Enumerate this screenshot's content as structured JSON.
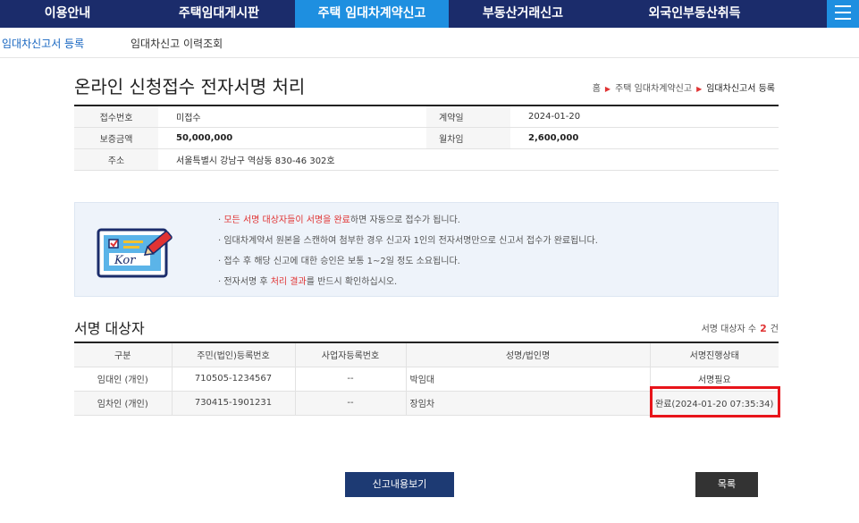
{
  "topnav": {
    "items": [
      "이용안내",
      "주택임대게시판",
      "주택 임대차계약신고",
      "부동산거래신고",
      "외국인부동산취득"
    ],
    "active_index": 2
  },
  "subnav": {
    "items": [
      "임대차신고서 등록",
      "임대차신고 이력조회"
    ]
  },
  "page": {
    "title": "온라인 신청접수 전자서명 처리",
    "breadcrumb": [
      "홈",
      "주택 임대차계약신고",
      "임대차신고서 등록"
    ]
  },
  "info": {
    "receipt_label": "접수번호",
    "receipt_value": "미접수",
    "contract_date_label": "계약일",
    "contract_date_value": "2024-01-20",
    "deposit_label": "보증금액",
    "deposit_value": "50,000,000",
    "rent_label": "월차임",
    "rent_value": "2,600,000",
    "address_label": "주소",
    "address_value": "서울특별시 강남구 역삼동 830-46 302호"
  },
  "notice": {
    "icon_text": "Kor",
    "line1_prefix": "· ",
    "line1_red": "모든 서명 대상자들이 서명을 완료",
    "line1_rest": "하면 자동으로 접수가 됩니다.",
    "line2": "· 임대차계약서 원본을 스캔하여 첨부한 경우 신고자 1인의 전자서명만으로 신고서 접수가 완료됩니다.",
    "line3": "· 접수 후 해당 신고에 대한 승인은 보통 1~2일 정도 소요됩니다.",
    "line4_prefix": "· 전자서명 후 ",
    "line4_red": "처리 결과",
    "line4_rest": "를 반드시 확인하십시오."
  },
  "signers": {
    "title": "서명 대상자",
    "count_label": "서명 대상자 수",
    "count_value": "2",
    "count_unit": "건",
    "headers": [
      "구분",
      "주민(법인)등록번호",
      "사업자등록번호",
      "성명/법인명",
      "서명진행상태"
    ],
    "rows": [
      {
        "type": "임대인 (개인)",
        "id": "710505-1234567",
        "biz": "--",
        "name": "박임대",
        "status": "서명필요"
      },
      {
        "type": "임차인 (개인)",
        "id": "730415-1901231",
        "biz": "--",
        "name": "장임차",
        "status": "완료(2024-01-20 07:35:34)"
      }
    ]
  },
  "buttons": {
    "view": "신고내용보기",
    "list": "목록"
  },
  "colors": {
    "nav_bg": "#1b2c6b",
    "nav_active": "#1e8fe0",
    "highlight": "#e8141a",
    "accent_red": "#e03333"
  }
}
